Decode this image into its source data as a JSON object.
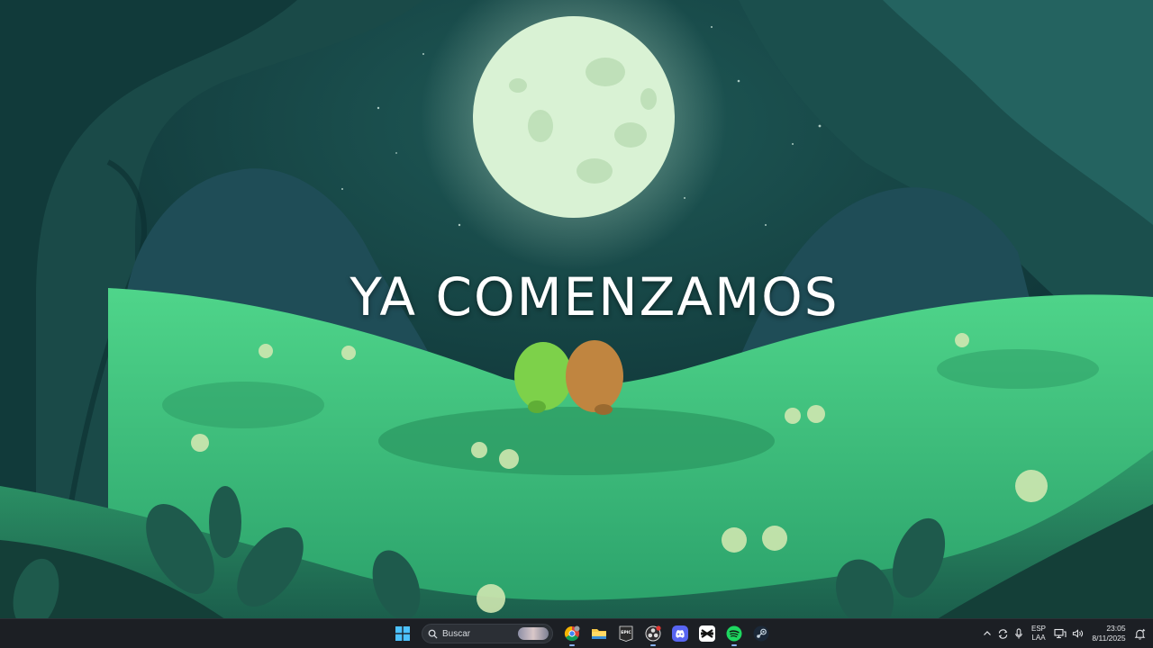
{
  "desktop": {
    "overlay_text": "YA COMENZAMOS"
  },
  "taskbar": {
    "search_placeholder": "Buscar",
    "apps": [
      {
        "name": "start",
        "icon": "windows-logo-icon"
      },
      {
        "name": "search",
        "icon": "search-icon"
      },
      {
        "name": "chrome",
        "icon": "chrome-icon"
      },
      {
        "name": "file-explorer",
        "icon": "folder-icon"
      },
      {
        "name": "epic-games",
        "icon": "epic-games-icon"
      },
      {
        "name": "obs",
        "icon": "obs-icon"
      },
      {
        "name": "discord",
        "icon": "discord-icon"
      },
      {
        "name": "capcut",
        "icon": "capcut-icon"
      },
      {
        "name": "spotify",
        "icon": "spotify-icon"
      },
      {
        "name": "steam",
        "icon": "steam-icon"
      }
    ],
    "epic_label": "EPIC",
    "tray": {
      "lang_line1": "ESP",
      "lang_line2": "LAA",
      "time": "23:05",
      "date": "8/11/2025"
    }
  },
  "colors": {
    "taskbar_bg": "#1c1f24",
    "moon": "#d9f2d4",
    "sky": "#0f3a3d",
    "meadow": "#3fbf7a"
  }
}
